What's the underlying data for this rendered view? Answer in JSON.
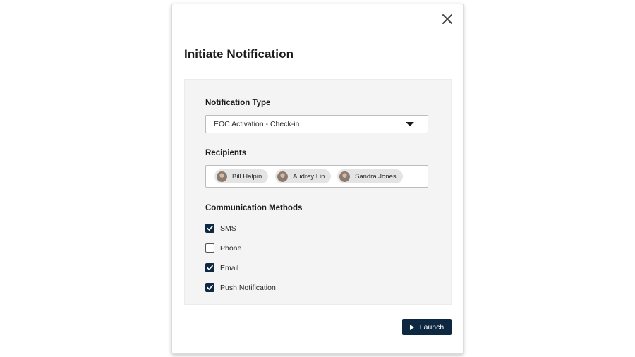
{
  "modal": {
    "title": "Initiate Notification",
    "close_icon": "close-icon"
  },
  "notification_type": {
    "label": "Notification Type",
    "selected": "EOC Activation - Check-in"
  },
  "recipients": {
    "label": "Recipients",
    "items": [
      {
        "name": "Bill Halpin"
      },
      {
        "name": "Audrey Lin"
      },
      {
        "name": "Sandra Jones"
      }
    ]
  },
  "communication_methods": {
    "label": "Communication Methods",
    "options": [
      {
        "label": "SMS",
        "checked": true
      },
      {
        "label": "Phone",
        "checked": false
      },
      {
        "label": "Email",
        "checked": true
      },
      {
        "label": "Push Notification",
        "checked": true
      }
    ]
  },
  "actions": {
    "launch_label": "Launch",
    "launch_icon": "play-icon"
  },
  "colors": {
    "primary": "#0f2842",
    "panel_bg": "#f4f4f4",
    "chip_bg": "#e4e4e4"
  }
}
